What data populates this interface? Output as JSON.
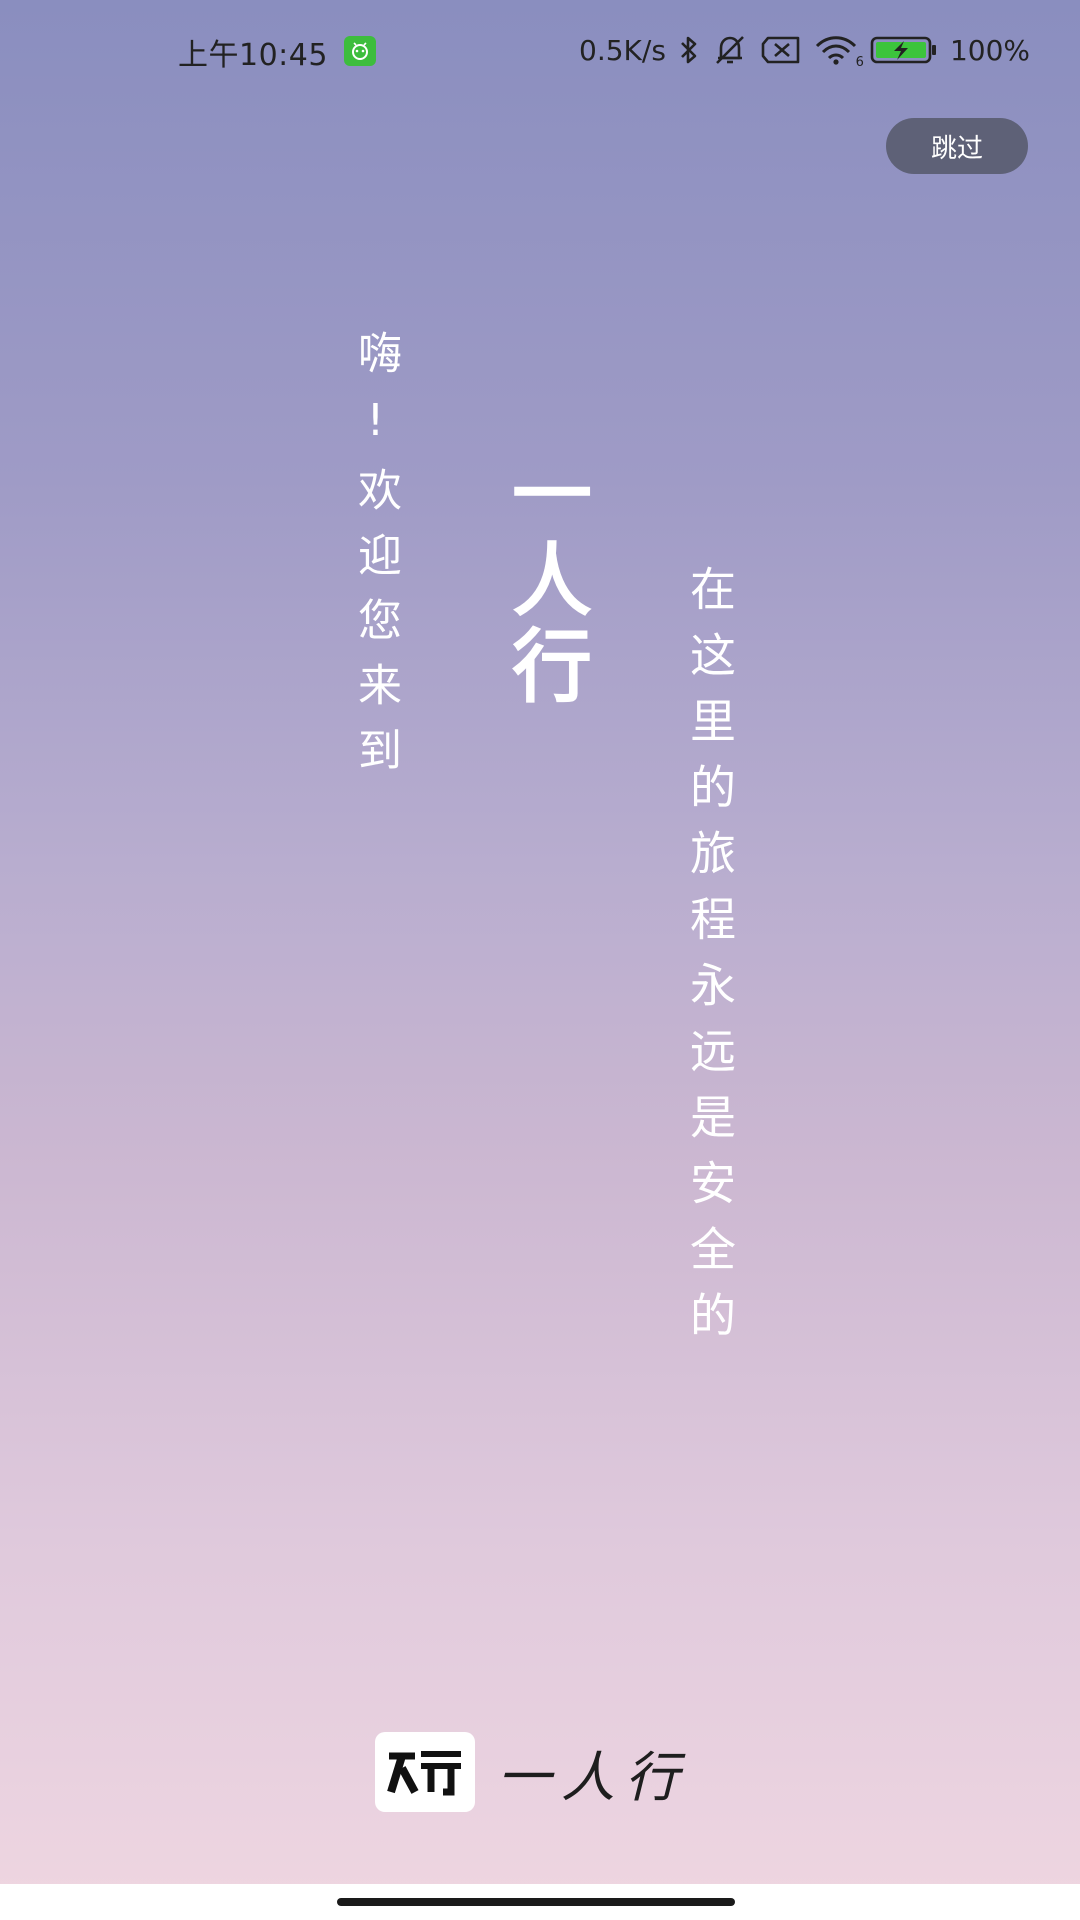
{
  "status_bar": {
    "time": "上午10:45",
    "network_speed": "0.5K/s",
    "wifi_badge": "6",
    "battery": "100%",
    "icons": [
      "app-notification-icon",
      "bluetooth-icon",
      "mute-bell-icon",
      "no-sim-icon",
      "wifi-icon",
      "battery-charging-icon"
    ]
  },
  "skip_button": {
    "label": "跳过"
  },
  "welcome": {
    "greeting": "嗨!欢迎您来到",
    "title": "一人行",
    "tagline": "在这里的旅程永远是安全的"
  },
  "logo": {
    "text": "一人行"
  },
  "colors": {
    "gradient_top": "#8a8ebf",
    "gradient_bottom": "#efd6e1",
    "skip_button_bg": "#5e6177",
    "battery_green": "#3cc43c"
  }
}
